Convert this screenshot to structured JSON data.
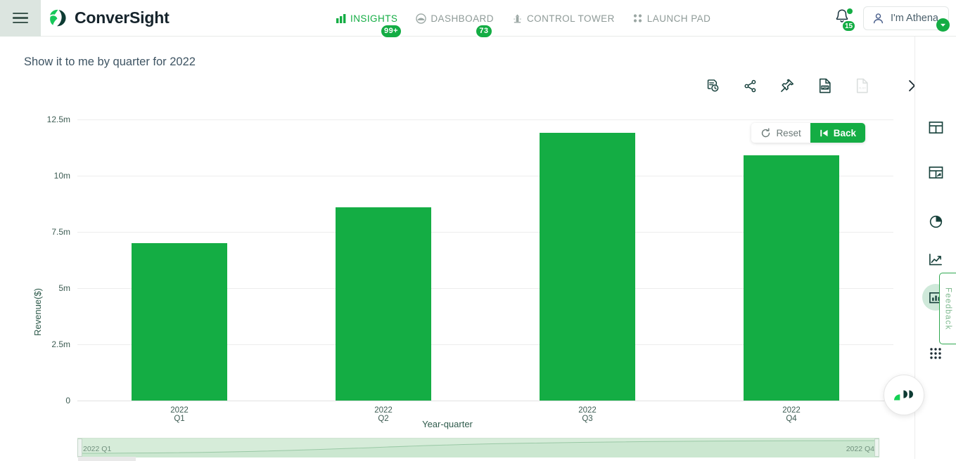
{
  "header": {
    "menu_icon": "hamburger-icon",
    "brand": "ConverSight",
    "nav": [
      {
        "label": "INSIGHTS",
        "icon": "insights-bar-icon",
        "badge": "99+",
        "active": true
      },
      {
        "label": "DASHBOARD",
        "icon": "dashboard-icon",
        "badge": "73",
        "active": false
      },
      {
        "label": "CONTROL TOWER",
        "icon": "control-tower-icon",
        "badge": "",
        "active": false
      },
      {
        "label": "LAUNCH PAD",
        "icon": "launch-pad-icon",
        "badge": "",
        "active": false
      }
    ],
    "notifications": {
      "icon": "bell-icon",
      "count": "15"
    },
    "user": {
      "label": "I'm Athena",
      "icon": "user-icon",
      "caret": "caret-down-icon"
    }
  },
  "page": {
    "title": "Show it to me by quarter for 2022"
  },
  "toolbar": [
    {
      "name": "history-icon",
      "label": "History",
      "disabled": false
    },
    {
      "name": "share-icon",
      "label": "Share",
      "disabled": false
    },
    {
      "name": "pin-icon",
      "label": "Pin",
      "disabled": false
    },
    {
      "name": "export-pdf-icon",
      "label": "PDF",
      "disabled": false
    },
    {
      "name": "export-xlsx-icon",
      "label": "XLSX",
      "disabled": true
    },
    {
      "name": "close-icon",
      "label": "Close",
      "disabled": false
    }
  ],
  "chart_actions": {
    "reset_label": "Reset",
    "reset_icon": "refresh-icon",
    "back_label": "Back",
    "back_icon": "step-back-icon"
  },
  "right_rail": [
    {
      "name": "table-view-icon",
      "label": "Table",
      "active": false
    },
    {
      "name": "pivot-table-icon",
      "label": "Pivot table",
      "active": false
    },
    {
      "name": "pie-chart-icon",
      "label": "Pie chart",
      "active": false
    },
    {
      "name": "line-chart-icon",
      "label": "Line chart",
      "active": false
    },
    {
      "name": "bar-chart-icon",
      "label": "Bar chart",
      "active": true
    },
    {
      "name": "more-views-icon",
      "label": "More",
      "active": false
    }
  ],
  "feedback": {
    "label": "Feedback"
  },
  "assistant": {
    "label": "Athena assistant"
  },
  "range_slider": {
    "start": "2022 Q1",
    "end": "2022 Q4"
  },
  "colors": {
    "brand_green": "#14ad44",
    "bar_green": "#14ad44",
    "axis_text": "#3d5c53",
    "grid": "#ededed",
    "slider_fill": "#d6ecd9"
  },
  "chart_data": {
    "type": "bar",
    "title": "",
    "categories": [
      "2022\nQ1",
      "2022\nQ2",
      "2022\nQ3",
      "2022\nQ4"
    ],
    "category_lines": [
      [
        "2022",
        "Q1"
      ],
      [
        "2022",
        "Q2"
      ],
      [
        "2022",
        "Q3"
      ],
      [
        "2022",
        "Q4"
      ]
    ],
    "values": [
      7.0,
      8.6,
      11.9,
      10.9
    ],
    "value_unit": "m",
    "series": [
      {
        "name": "Revenue($)",
        "values": [
          7.0,
          8.6,
          11.9,
          10.9
        ]
      }
    ],
    "xlabel": "Year-quarter",
    "ylabel": "Revenue($)",
    "ylim": [
      0,
      12.5
    ],
    "yticks": [
      0,
      2.5,
      5,
      7.5,
      10,
      12.5
    ],
    "ytick_labels": [
      "0",
      "2.5m",
      "5m",
      "7.5m",
      "10m",
      "12.5m"
    ],
    "grid": true,
    "legend": false,
    "bar_color": "#14ad44"
  }
}
